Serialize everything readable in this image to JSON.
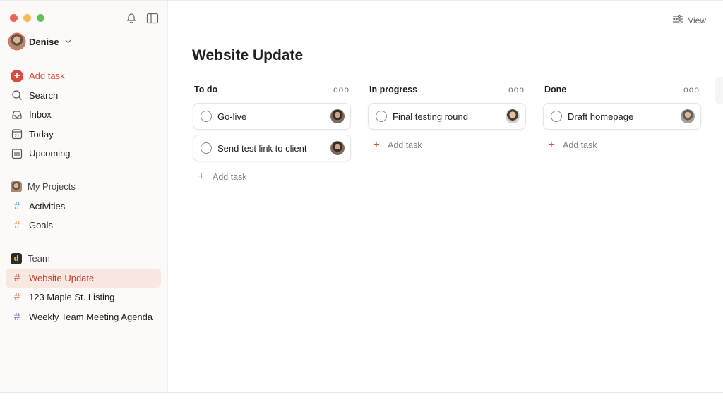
{
  "sidebar": {
    "user": {
      "name": "Denise"
    },
    "icons": [
      "bell-icon",
      "sidebar-toggle-icon"
    ],
    "nav": [
      {
        "label": "Add task",
        "icon": "plus-circle-icon"
      },
      {
        "label": "Search",
        "icon": "search-icon"
      },
      {
        "label": "Inbox",
        "icon": "inbox-icon"
      },
      {
        "label": "Today",
        "icon": "calendar-today-icon",
        "day": "21"
      },
      {
        "label": "Upcoming",
        "icon": "calendar-grid-icon"
      }
    ],
    "my_projects": {
      "title": "My Projects",
      "items": [
        {
          "label": "Activities",
          "color": "#3a9ad9"
        },
        {
          "label": "Goals",
          "color": "#e29b3a"
        }
      ]
    },
    "team": {
      "title": "Team",
      "logo_letter": "d",
      "items": [
        {
          "label": "Website Update",
          "color": "#dc4c3e",
          "active": true
        },
        {
          "label": "123 Maple St. Listing",
          "color": "#e27a5a"
        },
        {
          "label": "Weekly Team Meeting Agenda",
          "color": "#7b61c9"
        }
      ]
    }
  },
  "main": {
    "view_label": "View",
    "title": "Website Update",
    "columns": [
      {
        "title": "To do",
        "tasks": [
          "Go-live",
          "Send test link to client"
        ],
        "add_label": "Add task"
      },
      {
        "title": "In progress",
        "tasks": [
          "Final testing round"
        ],
        "add_label": "Add task"
      },
      {
        "title": "Done",
        "tasks": [
          "Draft homepage"
        ],
        "add_label": "Add task"
      }
    ],
    "more_glyph": "ooo"
  },
  "colors": {
    "accent": "#dc4c3e",
    "active_bg": "#f9e7e2",
    "sidebar_bg": "#fcfaf8"
  }
}
